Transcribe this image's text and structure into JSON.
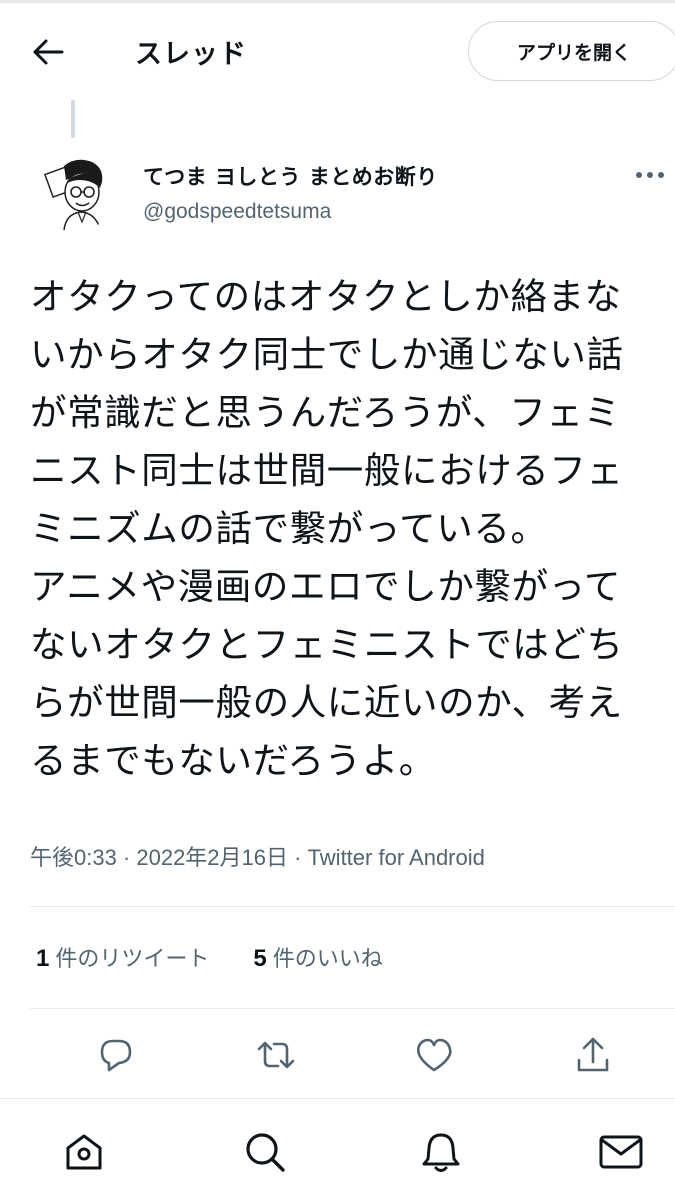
{
  "header": {
    "title": "スレッド",
    "open_app_label": "アプリを開く",
    "back_icon": "arrow-left-icon"
  },
  "tweet": {
    "display_name": "てつま ヨしとう まとめお断り",
    "handle": "@godspeedtetsuma",
    "body": "オタクってのはオタクとしか絡まないからオタク同士でしか通じない話が常識だと思うんだろうが、フェミニスト同士は世間一般におけるフェミニズムの話で繋がっている。\nアニメや漫画のエロでしか繋がってないオタクとフェミニストではどちらが世間一般の人に近いのか、考えるまでもないだろうよ。",
    "timestamp": "午後0:33 · 2022年2月16日 · Twitter for Android",
    "retweet_count": "1",
    "retweet_label": "件のリツイート",
    "like_count": "5",
    "like_label": "件のいいね"
  },
  "actions": [
    "reply-icon",
    "retweet-icon",
    "like-icon",
    "share-icon"
  ],
  "bottom_nav": [
    "home-icon",
    "search-icon",
    "notifications-icon",
    "messages-icon"
  ],
  "colors": {
    "text": "#0f1419",
    "secondary": "#536471",
    "border": "#cfd9de"
  }
}
